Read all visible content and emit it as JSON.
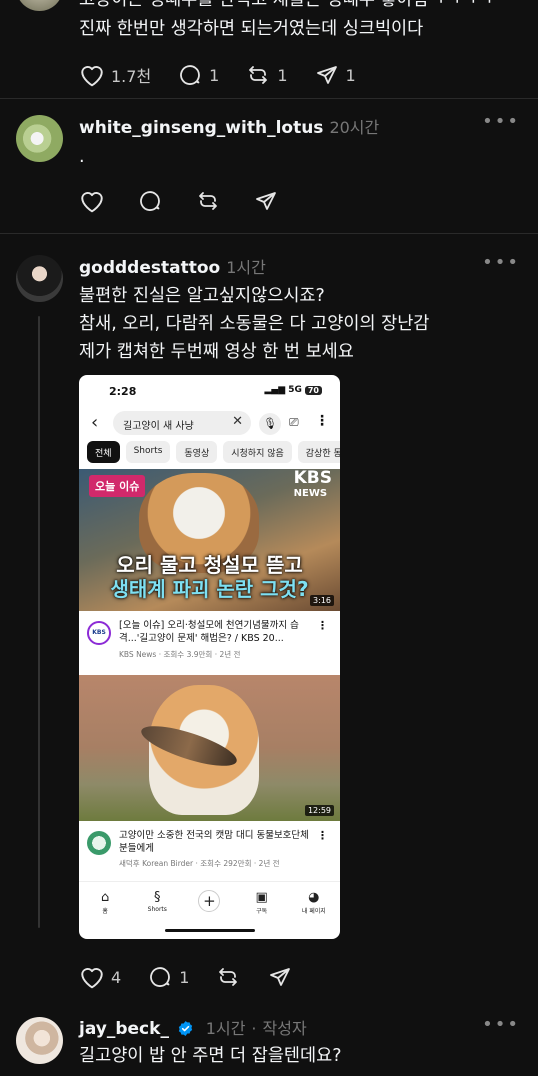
{
  "post_top": {
    "text_line1": "고양이는 멍때주를 안먹고 재들은 멍때주 좋아함ㅋㅋㅋㅋ",
    "text_line2": "진짜 한번만 생각하면 되는거였는데 싱크빅이다",
    "likes": "1.7천",
    "comments": "1",
    "reposts": "1",
    "shares": "1"
  },
  "post2": {
    "username": "white_ginseng_with_lotus",
    "time": "20시간",
    "text": "."
  },
  "post3": {
    "username": "godddestattoo",
    "time": "1시간",
    "line1": "불편한 진실은 알고싶지않으시죠?",
    "line2": "참새, 오리, 다람쥐 소동물은 다 고양이의 장난감",
    "line3": "제가 캡쳐한 두번째 영상 한 번 보세요",
    "likes": "4",
    "comments": "1"
  },
  "screenshot": {
    "status_time": "2:28",
    "network": "5G",
    "battery": "70",
    "search_query": "길고양이 새 사냥",
    "chips": [
      "전체",
      "Shorts",
      "동영상",
      "시청하지 않음",
      "감상한 동"
    ],
    "video1": {
      "badge": "오늘 이슈",
      "brand": "KBS",
      "brand_sub": "NEWS",
      "headline1": "오리 물고 청설모 뜯고",
      "headline2": "생태계 파괴 논란 그것?",
      "duration": "3:16",
      "title": "[오늘 이슈] 오리·청설모에 천연기념물까지 습격...'길고양이 문제' 해법은? / KBS 20...",
      "channel_line": "KBS News · 조회수 3.9만회 · 2년 전",
      "avatar_text": "KBS"
    },
    "video2": {
      "duration": "12:59",
      "title": "고양이만 소중한 전국의 캣맘 대디 동물보호단체분들에게",
      "channel_line": "새덕후 Korean Birder · 조회수 292만회 · 2년 전"
    },
    "nav": [
      "홈",
      "Shorts",
      "",
      "구독",
      "내 페이지"
    ]
  },
  "post4": {
    "username": "jay_beck_",
    "time": "1시간",
    "author_tag": "작성자",
    "text": "길고양이 밥 안 주면 더 잡을텐데요?"
  },
  "colors": {
    "background": "#101010",
    "text": "#f3f5f7",
    "muted": "#777777",
    "verified": "#0095f6"
  }
}
